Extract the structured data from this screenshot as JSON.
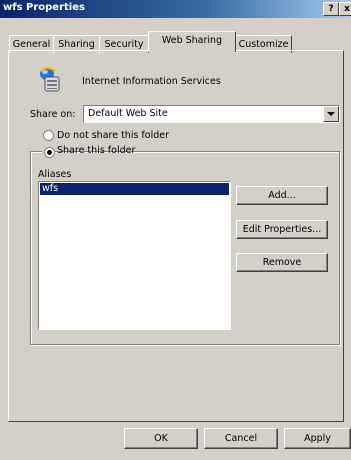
{
  "window": {
    "title": "wfs Properties",
    "help_label": "?",
    "close_label": "x"
  },
  "tabs": [
    {
      "label": "General",
      "active": false
    },
    {
      "label": "Sharing",
      "active": false
    },
    {
      "label": "Security",
      "active": false
    },
    {
      "label": "Web Sharing",
      "active": true
    },
    {
      "label": "Customize",
      "active": false
    }
  ],
  "header": {
    "icon": "iis-icon",
    "text": "Internet Information Services"
  },
  "share_on": {
    "label": "Share on:",
    "value": "Default Web Site"
  },
  "radios": {
    "not_share": {
      "label": "Do not share this folder",
      "selected": false
    },
    "share": {
      "label": "Share this folder",
      "selected": true
    }
  },
  "aliases": {
    "label": "Aliases",
    "items": [
      "wfs"
    ],
    "selected_index": 0
  },
  "side_buttons": {
    "add": "Add...",
    "edit": "Edit Properties...",
    "remove": "Remove"
  },
  "footer_buttons": {
    "ok": "OK",
    "cancel": "Cancel",
    "apply": "Apply"
  },
  "colors": {
    "titlebar": "#0a246a",
    "face": "#d4d0c8",
    "selection": "#0a246a"
  }
}
